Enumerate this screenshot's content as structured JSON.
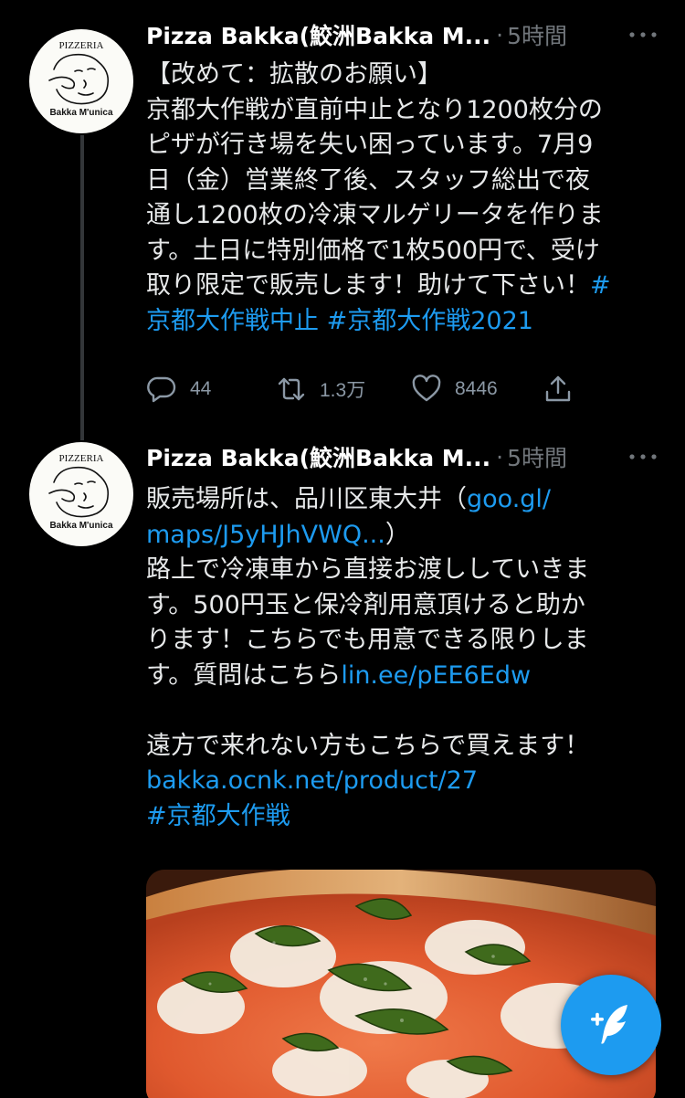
{
  "tweets": [
    {
      "avatar_text": {
        "top": "PIZZERIA",
        "bottom": "Bakka M'unica"
      },
      "name": "Pizza Bakka(鮫洲Bakka M...",
      "separator": "·",
      "time": "5時間",
      "lines": [
        "【改めて：拡散のお願い】",
        "京都大作戦が直前中止となり1200枚分の",
        "ピザが行き場を失い困っています。7月9",
        "日（金）営業終了後、スタッフ総出で夜",
        "通し1200枚の冷凍マルゲリータを作りま",
        "す。土日に特別価格で1枚500円で、受け"
      ],
      "line7_text": "取り限定で販売します！助けて下さい！",
      "line7_link": "#",
      "line8_link1": "京都大作戦中止",
      "line8_space": " ",
      "line8_link2": "#京都大作戦2021",
      "reply_count": "44",
      "retweet_count": "1.3万",
      "like_count": "8446"
    },
    {
      "avatar_text": {
        "top": "PIZZERIA",
        "bottom": "Bakka M'unica"
      },
      "name": "Pizza Bakka(鮫洲Bakka M...",
      "separator": "·",
      "time": "5時間",
      "l1_text": "販売場所は、品川区東大井（",
      "l1_link": "goo.gl/",
      "l2_link": "maps/J5yHJhVWQ...",
      "l2_text": "）",
      "l3": "路上で冷凍車から直接お渡ししていきま",
      "l4": "す。500円玉と保冷剤用意頂けると助か",
      "l5": "ります！こちらでも用意できる限りしま",
      "l6_text": "す。質問はこちら",
      "l6_link": "lin.ee/pEE6Edw",
      "l8": "遠方で来れない方もこちらで買えます！",
      "l9_link": "bakka.ocnk.net/product/27",
      "l10_link": "#京都大作戦"
    }
  ],
  "colors": {
    "background": "#000000",
    "accent": "#1d9bf0",
    "muted": "#71767b",
    "text": "#e7e9ea"
  },
  "icons": [
    "more-icon",
    "reply-icon",
    "retweet-icon",
    "like-icon",
    "share-icon",
    "compose-tweet-icon"
  ]
}
